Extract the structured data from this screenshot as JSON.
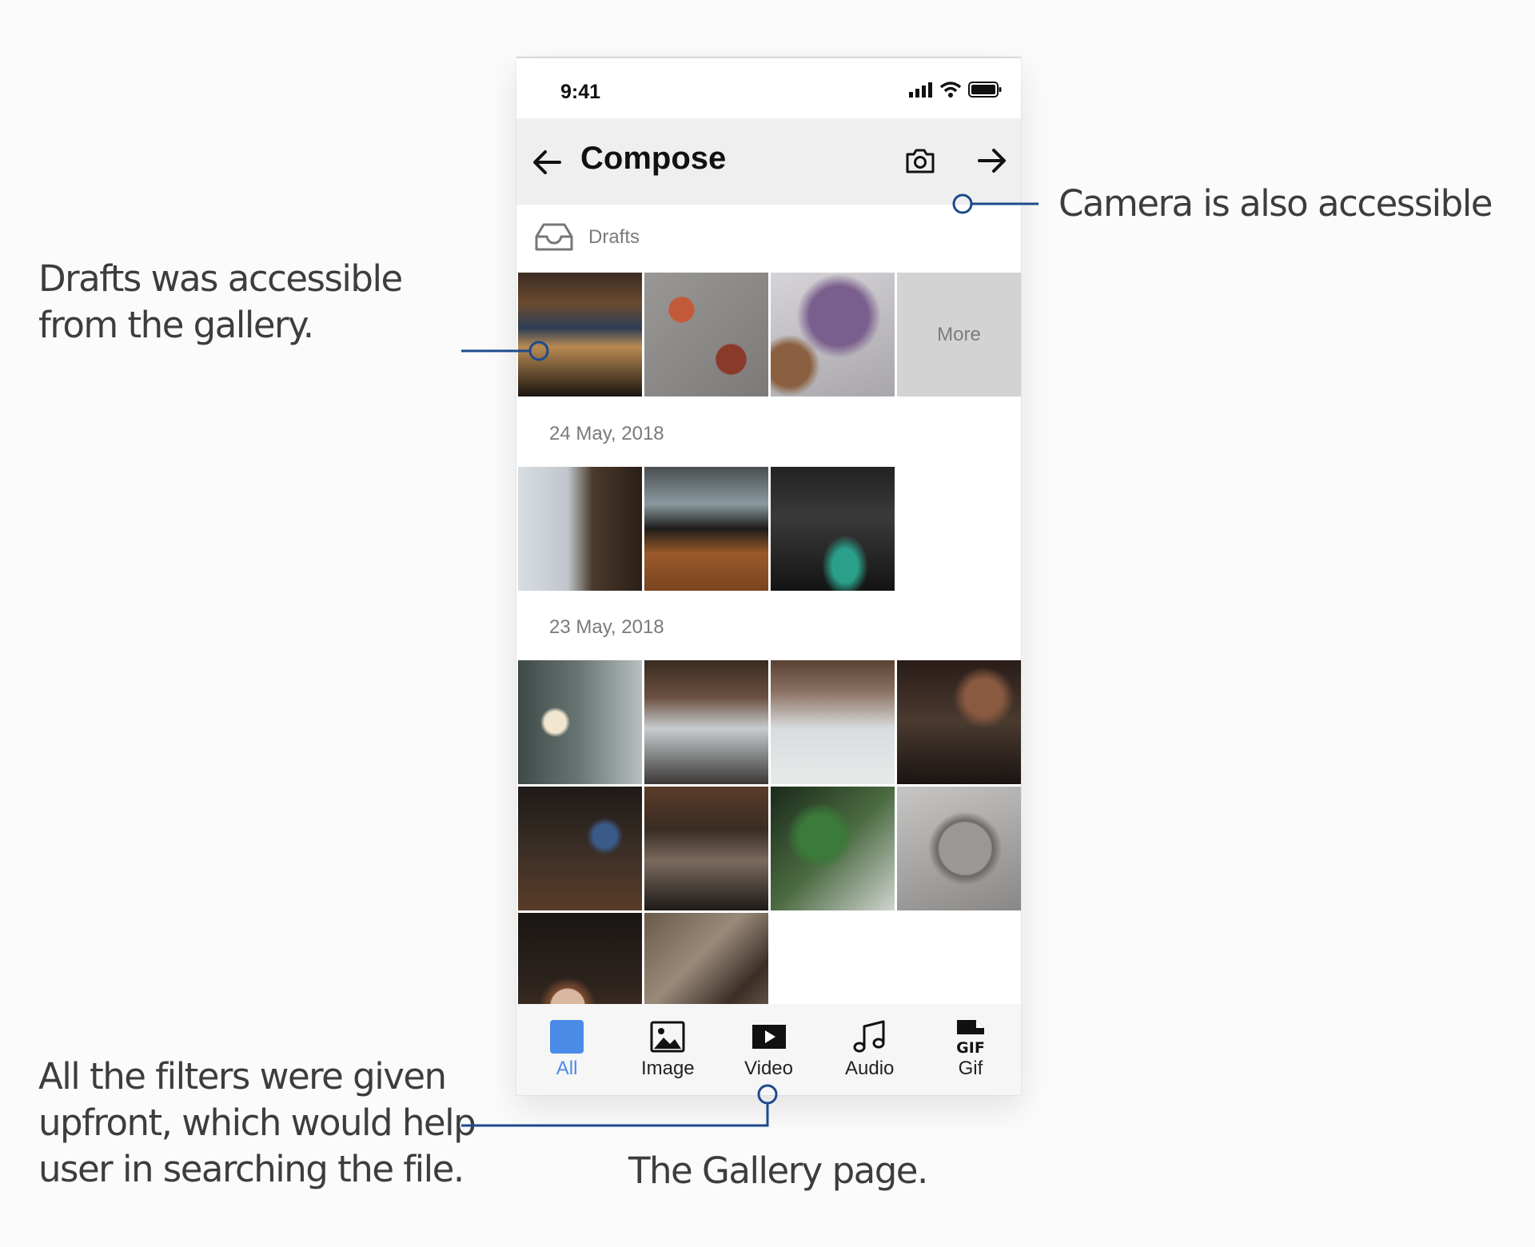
{
  "annotations": {
    "drafts_note": "Drafts was accessible\nfrom the gallery.",
    "camera_note": "Camera is also accessible",
    "filters_note": "All the filters were given\nupfront, which would help\nuser in searching the file.",
    "caption": "The Gallery page."
  },
  "colors": {
    "accent": "#4a8be8",
    "connector": "#1c4a8c"
  },
  "status_bar": {
    "time": "9:41",
    "icons": [
      "signal-icon",
      "wifi-icon",
      "battery-icon"
    ]
  },
  "app_bar": {
    "title": "Compose",
    "back_icon": "arrow-left-icon",
    "camera_icon": "camera-icon",
    "next_icon": "arrow-right-icon"
  },
  "drafts": {
    "label": "Drafts",
    "icon": "inbox-tray-icon",
    "more_label": "More"
  },
  "sections": [
    {
      "date": "24 May, 2018",
      "photo_count": 3
    },
    {
      "date": "23 May, 2018",
      "photo_count": 10
    }
  ],
  "filters": [
    {
      "label": "All",
      "icon": "all-square-icon",
      "active": true
    },
    {
      "label": "Image",
      "icon": "image-icon",
      "active": false
    },
    {
      "label": "Video",
      "icon": "video-icon",
      "active": false
    },
    {
      "label": "Audio",
      "icon": "audio-note-icon",
      "active": false
    },
    {
      "label": "Gif",
      "icon": "gif-file-icon",
      "active": false
    }
  ]
}
